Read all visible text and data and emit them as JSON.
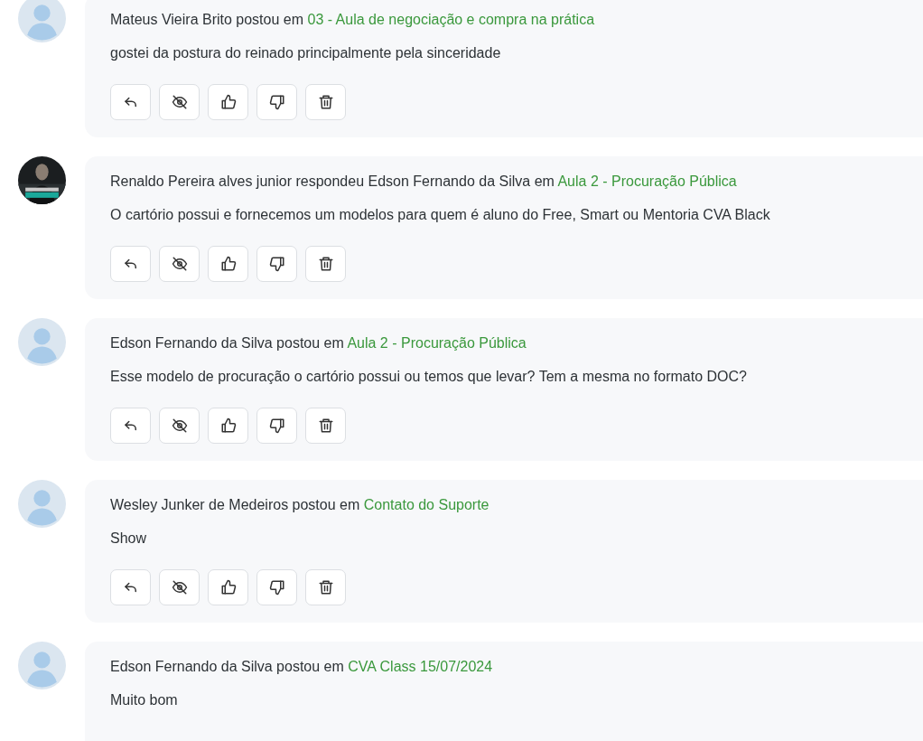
{
  "actions": [
    {
      "kind": "reply"
    },
    {
      "kind": "hide"
    },
    {
      "kind": "like"
    },
    {
      "kind": "dislike"
    },
    {
      "kind": "delete"
    }
  ],
  "posts": [
    {
      "avatar": {
        "kind": "placeholder"
      },
      "header": "Mateus Vieira Brito postou em",
      "link": "03 - Aula de negociação e compra na prática",
      "body": "gostei da postura do reinado principalmente pela sinceridade",
      "actions_visible": true
    },
    {
      "header": "Renaldo Pereira alves junior respondeu Edson Fernando da Silva em",
      "link": "Aula 2 - Procuração Pública",
      "body": "O cartório possui e fornecemos um modelos para quem é aluno do Free, Smart ou Mentoria CVA Black",
      "actions_visible": true
    },
    {
      "avatar": {
        "kind": "placeholder"
      },
      "header": "Edson Fernando da Silva postou em",
      "link": "Aula 2 - Procuração Pública",
      "body": "Esse modelo de procuração o cartório possui ou temos que levar? Tem a mesma no formato DOC?",
      "actions_visible": true
    },
    {
      "avatar": {
        "kind": "placeholder"
      },
      "header": "Wesley Junker de Medeiros postou em",
      "link": "Contato do Suporte",
      "body": "Show",
      "actions_visible": true
    },
    {
      "avatar": {
        "kind": "placeholder"
      },
      "header": "Edson Fernando da Silva postou em",
      "link": "CVA Class 15/07/2024",
      "body": "Muito bom",
      "actions_visible": false
    }
  ]
}
